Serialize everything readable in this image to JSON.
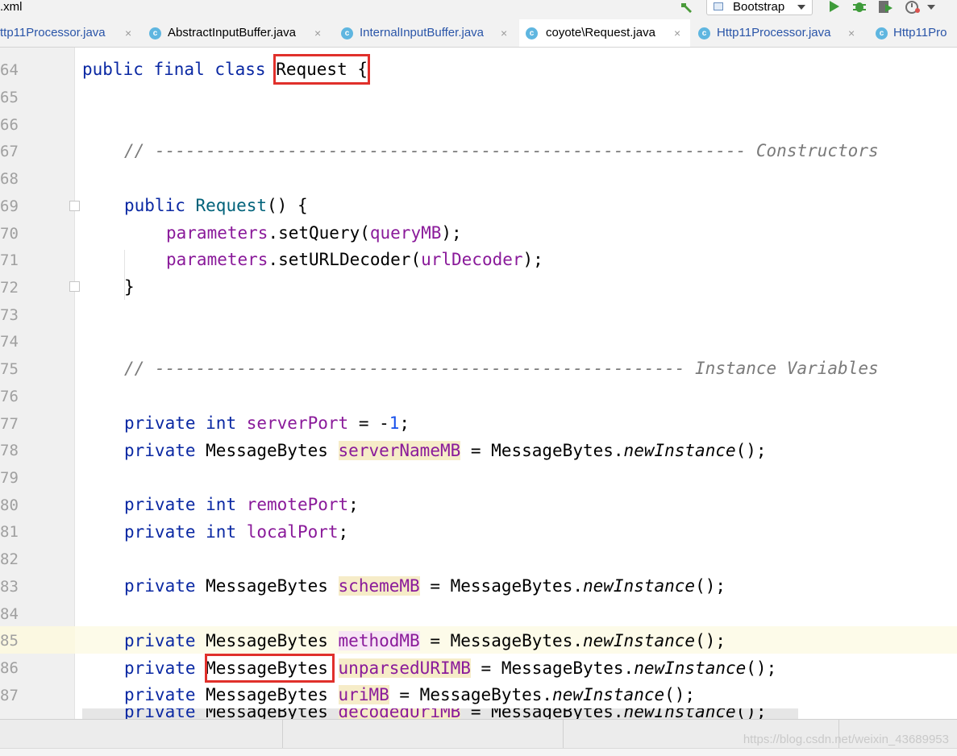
{
  "topbar": {
    "breadcrumb": ".xml",
    "run_config": "Bootstrap"
  },
  "tabs": [
    {
      "label": "ttp11Processor.java",
      "close": "×"
    },
    {
      "label": "AbstractInputBuffer.java",
      "close": "×"
    },
    {
      "label": "InternalInputBuffer.java",
      "close": "×"
    },
    {
      "label": "coyote\\Request.java",
      "close": "×",
      "active": true
    },
    {
      "label": "Http11Processor.java",
      "close": "×"
    },
    {
      "label": "Http11Pro",
      "close": ""
    }
  ],
  "gutter": {
    "lines": [
      "64",
      "65",
      "66",
      "67",
      "68",
      "69",
      "70",
      "71",
      "72",
      "73",
      "74",
      "75",
      "76",
      "77",
      "78",
      "79",
      "80",
      "81",
      "82",
      "83",
      "84",
      "85",
      "86",
      "87"
    ]
  },
  "code": {
    "l64": {
      "a": "public final class ",
      "b": "Request",
      "c": " {"
    },
    "l67": {
      "a": "// ",
      "b": "----------------------------------------------------------",
      "c": " Constructors"
    },
    "l69": {
      "a": "public ",
      "b": "Request",
      "c": "() {"
    },
    "l70": {
      "a": "parameters",
      "b": ".setQuery(",
      "c": "queryMB",
      "d": ");"
    },
    "l71": {
      "a": "parameters",
      "b": ".setURLDecoder(",
      "c": "urlDecoder",
      "d": ");"
    },
    "l72": {
      "a": "}"
    },
    "l75": {
      "a": "// ",
      "b": "----------------------------------------------------",
      "c": " Instance Variables"
    },
    "l77": {
      "a": "private ",
      "b": "int ",
      "c": "serverPort",
      "d": " = -",
      "e": "1",
      "f": ";"
    },
    "l78": {
      "a": "private ",
      "b": "MessageBytes ",
      "c": "serverNameMB",
      "d": " = MessageBytes.",
      "e": "newInstance",
      "f": "();"
    },
    "l80": {
      "a": "private ",
      "b": "int ",
      "c": "remotePort",
      "d": ";"
    },
    "l81": {
      "a": "private ",
      "b": "int ",
      "c": "localPort",
      "d": ";"
    },
    "l83": {
      "a": "private ",
      "b": "MessageBytes ",
      "c": "schemeMB",
      "d": " = MessageBytes.",
      "e": "newInstance",
      "f": "();"
    },
    "l85": {
      "a": "private ",
      "b": "MessageBytes ",
      "c": "methodMB",
      "d": " = MessageBytes.",
      "e": "newInstance",
      "f": "();"
    },
    "l86": {
      "a": "private ",
      "b": "MessageBytes",
      "c": " ",
      "d": "unparsedURIMB",
      "e": " = MessageBytes.",
      "f": "newInstance",
      "g": "();"
    },
    "l87": {
      "a": "private ",
      "b": "MessageBytes ",
      "c": "uriMB",
      "d": " = MessageBytes.",
      "e": "newInstance",
      "f": "();"
    },
    "l88": {
      "a": "private ",
      "b": "MessageBytes ",
      "c": "decodedUriMB",
      "d": " = MessageBytes.",
      "e": "newInstance",
      "f": "();"
    }
  },
  "status": {
    "watermark": "https://blog.csdn.net/weixin_43689953"
  },
  "colors": {
    "keyword": "#0a28a3",
    "field": "#8a1a9a",
    "highlight": "#f6ecc8",
    "annotation_box": "#e0302b"
  }
}
